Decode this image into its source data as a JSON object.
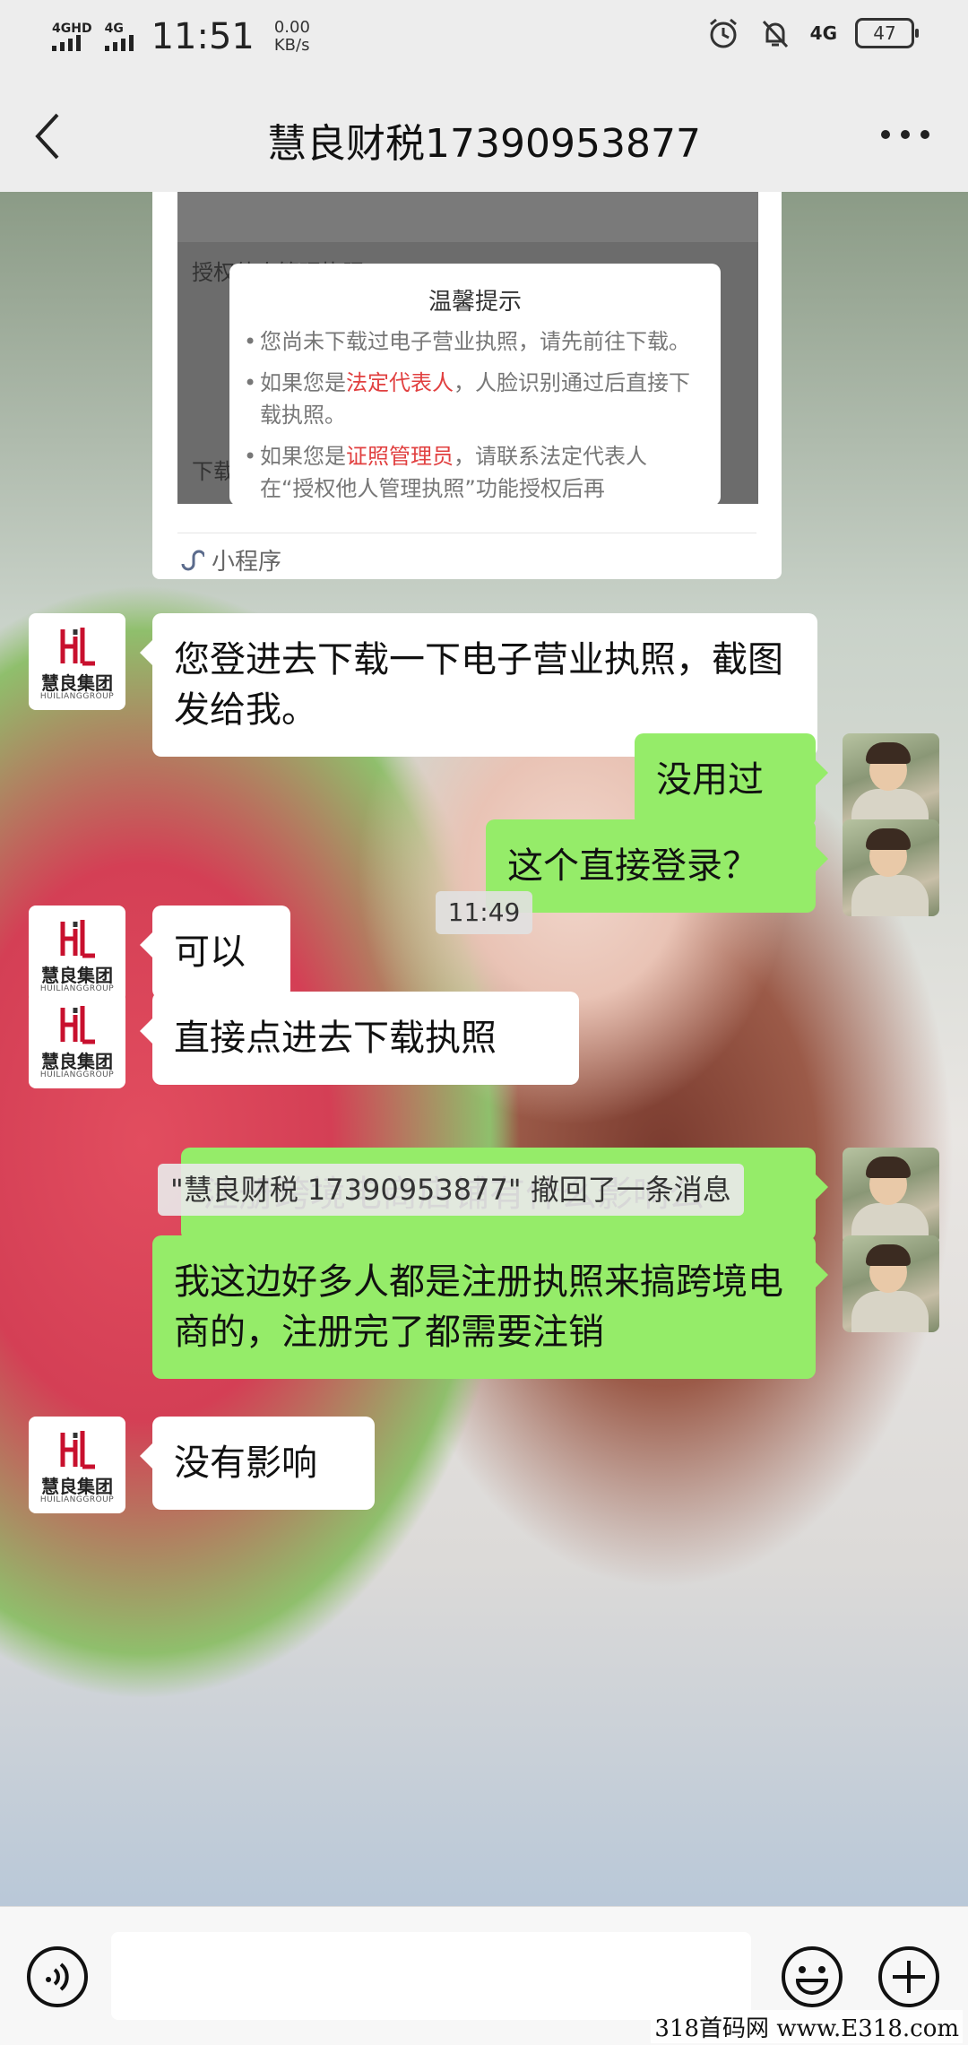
{
  "status_bar": {
    "net1": "4GHD",
    "net2": "4G",
    "time": "11:51",
    "speed_value": "0.00",
    "speed_unit": "KB/s",
    "net3": "4G",
    "battery": "47"
  },
  "header": {
    "title": "慧良财税17390953877"
  },
  "mini_program": {
    "ghost_text_1": "授权他人管理执照",
    "ghost_text_2": "下载",
    "tip_title": "温馨提示",
    "tip_1": "您尚未下载过电子营业执照，请先前往下载。",
    "tip_2_pre": "如果您是",
    "tip_2_em": "法定代表人",
    "tip_2_post": "，人脸识别通过后直接下载执照。",
    "tip_3_pre": "如果您是",
    "tip_3_em": "证照管理员",
    "tip_3_post": "，请联系法定代表人在“授权他人管理执照”功能授权后再",
    "footer": "小程序"
  },
  "contact_avatar": {
    "name_cn": "慧良集团",
    "name_en": "HUILIANGGROUP"
  },
  "messages": [
    {
      "side": "in",
      "text": "您登进去下载一下电子营业执照，截图发给我。"
    },
    {
      "side": "out",
      "text": "没用过"
    },
    {
      "side": "out",
      "text": "这个直接登录？"
    },
    {
      "side": "in",
      "text": "可以"
    },
    {
      "side": "in",
      "text": "直接点进去下载执照"
    },
    {
      "side": "out",
      "text": "注册跨境电商店铺有什么影响么"
    },
    {
      "side": "out",
      "text": "我这边好多人都是注册执照来搞跨境电商的，注册完了都需要注销"
    },
    {
      "side": "in",
      "text": "没有影响"
    }
  ],
  "time_divider": "11:49",
  "recall_notice": "\"慧良财税 17390953877\" 撤回了一条消息",
  "watermark": "318首码网 www.E318.com",
  "colors": {
    "out_bubble": "#95ec69",
    "in_bubble": "#ffffff",
    "accent_red": "#e14040"
  }
}
